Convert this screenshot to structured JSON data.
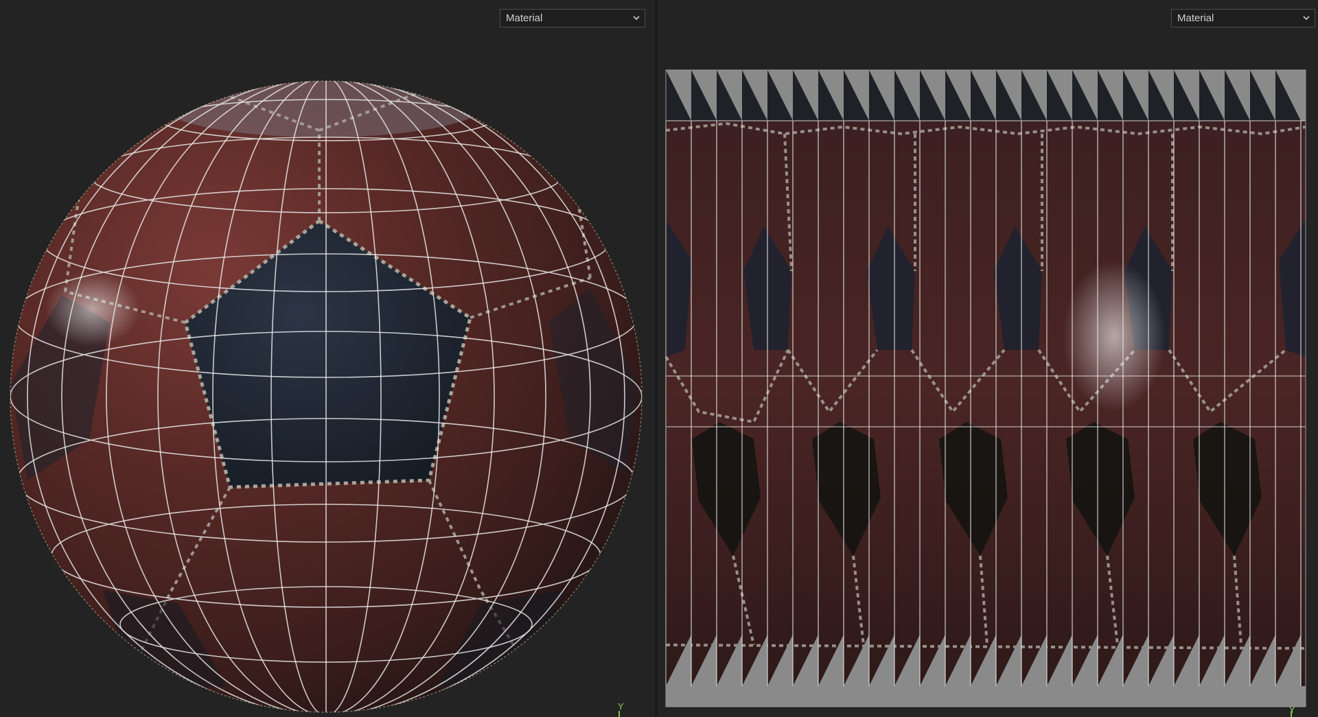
{
  "viewports": {
    "left": {
      "shading_mode": "Material",
      "axis_label": "Y"
    },
    "right": {
      "shading_mode": "Material",
      "axis_label": "Y"
    }
  },
  "icons": {
    "dropdown": "chevron-down-icon"
  },
  "colors": {
    "background": "#222222",
    "leather_red": "#5a2a27",
    "leather_dark": "#1f2630",
    "wireframe": "#e8e8e8",
    "uv_border": "#8a8a8a",
    "axis": "#7bc24f"
  }
}
